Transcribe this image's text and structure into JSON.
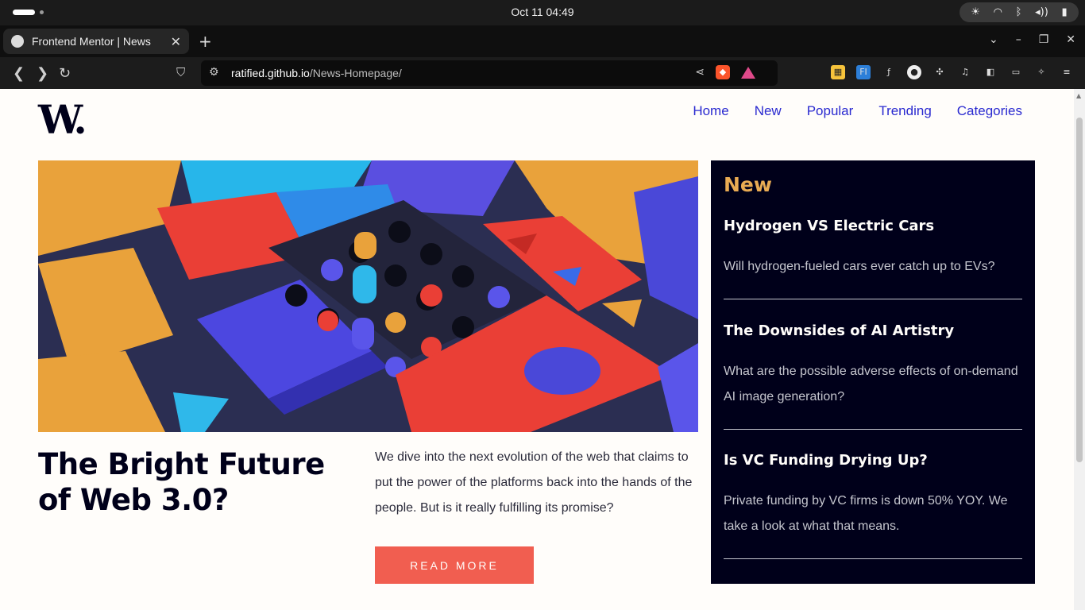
{
  "os": {
    "clock": "Oct 11  04:49"
  },
  "browser": {
    "tab_title": "Frontend Mentor | News",
    "url_host": "ratified.github.io",
    "url_path": "/News-Homepage/"
  },
  "site": {
    "logo": "W.",
    "nav": [
      "Home",
      "New",
      "Popular",
      "Trending",
      "Categories"
    ],
    "hero_alt": "Abstract colorful 3D blocks",
    "headline": "The Bright Future of Web 3.0?",
    "lede": "We dive into the next evolution of the web that claims to put the power of the platforms back into the hands of the people. But is it really fulfilling its promise?",
    "read_more": "READ MORE",
    "aside": {
      "title": "New",
      "items": [
        {
          "title": "Hydrogen VS Electric Cars",
          "desc": "Will hydrogen-fueled cars ever catch up to EVs?"
        },
        {
          "title": "The Downsides of AI Artistry",
          "desc": "What are the possible adverse effects of on-demand AI image generation?"
        },
        {
          "title": "Is VC Funding Drying Up?",
          "desc": "Private funding by VC firms is down 50% YOY. We take a look at what that means."
        }
      ]
    }
  },
  "colors": {
    "accent_red": "#f15e50",
    "accent_orange": "#e9ab53",
    "dark_navy": "#00001a",
    "nav_link": "#2a2ad0",
    "page_bg": "#fffdfa"
  }
}
